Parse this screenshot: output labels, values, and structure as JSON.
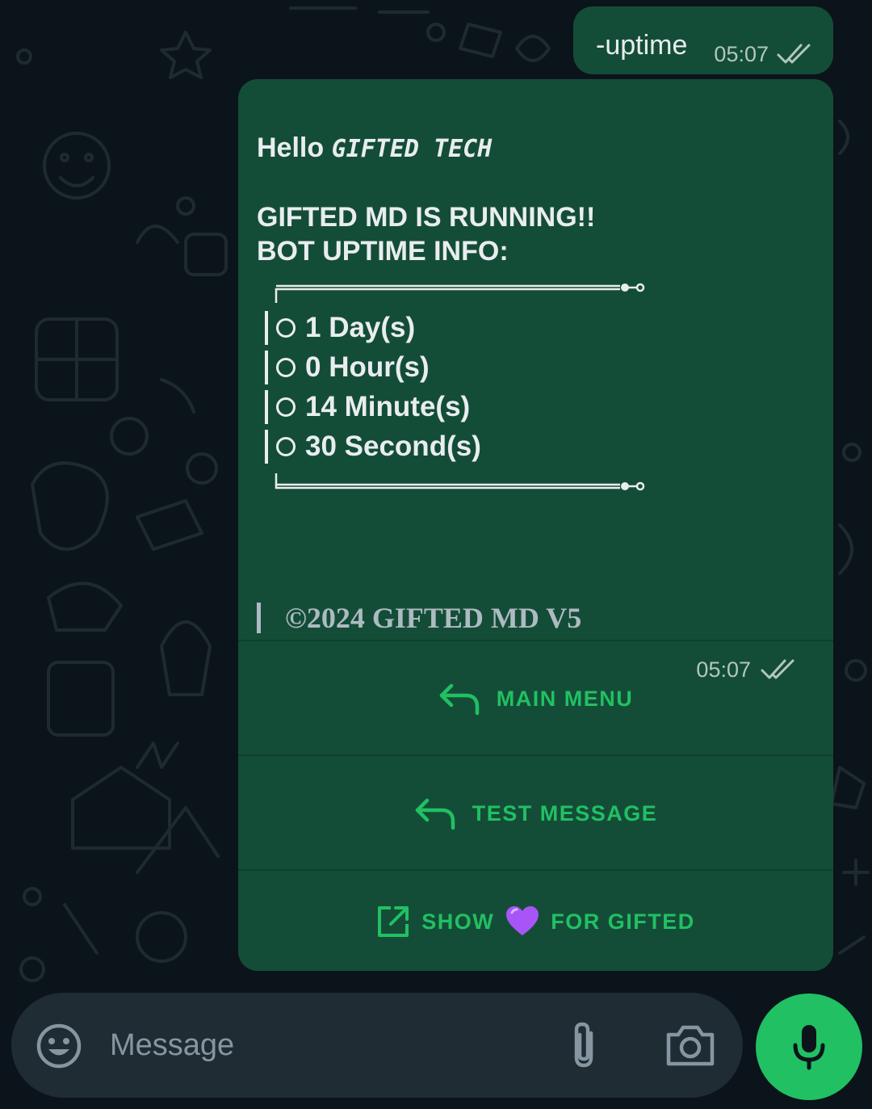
{
  "outgoing": {
    "text": "-uptime",
    "time": "05:07"
  },
  "bot_message": {
    "greeting_prefix": "Hello",
    "greeting_name": "GIFTED TECH",
    "line1": "GIFTED MD IS RUNNING!!",
    "line2": "BOT UPTIME INFO:",
    "uptime": [
      "1 Day(s)",
      "0 Hour(s)",
      "14 Minute(s)",
      "30 Second(s)"
    ],
    "footer": "©2024 GIFTED MD V5",
    "time": "05:07"
  },
  "buttons": [
    {
      "label": "MAIN MENU",
      "icon": "reply-icon"
    },
    {
      "label": "TEST MESSAGE",
      "icon": "reply-icon"
    },
    {
      "label_prefix": "SHOW",
      "emoji": "💜",
      "label_suffix": "FOR GIFTED",
      "icon": "external-link-icon"
    }
  ],
  "input": {
    "placeholder": "Message"
  },
  "colors": {
    "bubble": "#144d37",
    "accent": "#21c063",
    "background": "#0b141a",
    "input_bg": "#1f2c34"
  }
}
